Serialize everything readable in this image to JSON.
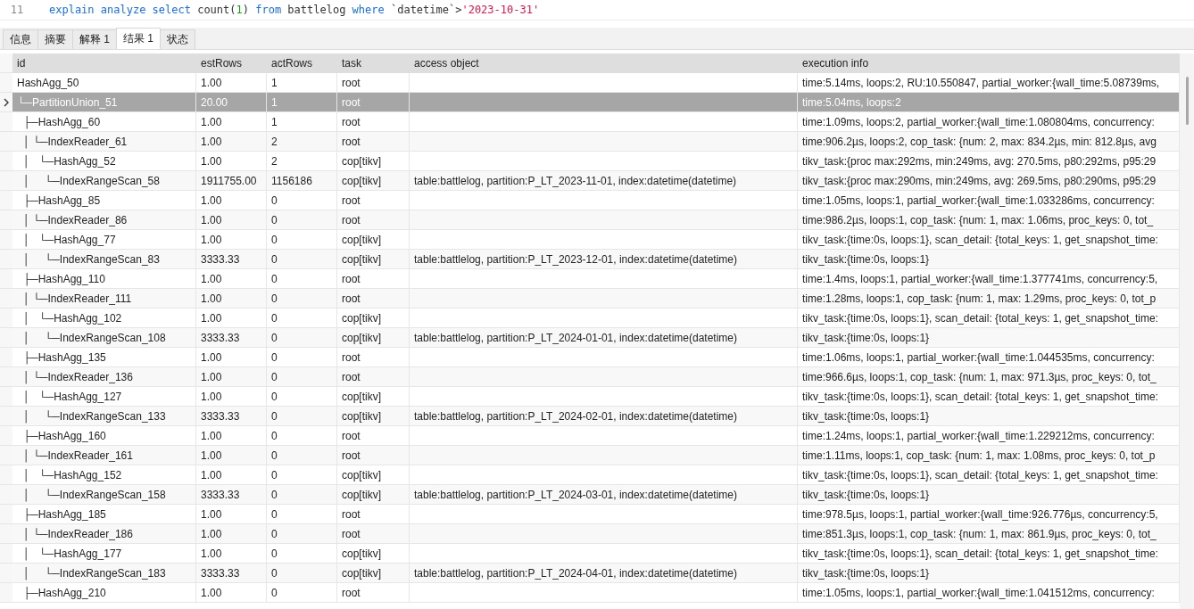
{
  "editor": {
    "line_number": "11",
    "tokens": [
      {
        "kind": "keyword",
        "text": "explain analyze select "
      },
      {
        "kind": "plain",
        "text": "count("
      },
      {
        "kind": "number",
        "text": "1"
      },
      {
        "kind": "plain",
        "text": ") "
      },
      {
        "kind": "keyword",
        "text": "from "
      },
      {
        "kind": "plain",
        "text": "battlelog "
      },
      {
        "kind": "keyword",
        "text": "where "
      },
      {
        "kind": "plain",
        "text": "`datetime`>"
      },
      {
        "kind": "string",
        "text": "'2023-10-31'"
      }
    ]
  },
  "tabs": [
    {
      "label": "信息",
      "selected": false
    },
    {
      "label": "摘要",
      "selected": false
    },
    {
      "label": "解释 1",
      "selected": false
    },
    {
      "label": "结果 1",
      "selected": true
    },
    {
      "label": "状态",
      "selected": false
    }
  ],
  "table": {
    "columns": [
      "id",
      "estRows",
      "actRows",
      "task",
      "access object",
      "execution info"
    ],
    "rows": [
      {
        "selected": false,
        "cells": [
          "HashAgg_50",
          "1.00",
          "1",
          "root",
          "",
          "time:5.14ms, loops:2, RU:10.550847, partial_worker:{wall_time:5.08739ms,"
        ]
      },
      {
        "selected": true,
        "cells": [
          "└─PartitionUnion_51",
          "20.00",
          "1",
          "root",
          "",
          "time:5.04ms, loops:2"
        ]
      },
      {
        "selected": false,
        "cells": [
          "  ├─HashAgg_60",
          "1.00",
          "1",
          "root",
          "",
          "time:1.09ms, loops:2, partial_worker:{wall_time:1.080804ms, concurrency:"
        ]
      },
      {
        "selected": false,
        "cells": [
          "  │ └─IndexReader_61",
          "1.00",
          "2",
          "root",
          "",
          "time:906.2µs, loops:2, cop_task: {num: 2, max: 834.2µs, min: 812.8µs, avg"
        ]
      },
      {
        "selected": false,
        "cells": [
          "  │   └─HashAgg_52",
          "1.00",
          "2",
          "cop[tikv]",
          "",
          "tikv_task:{proc max:292ms, min:249ms, avg: 270.5ms, p80:292ms, p95:29"
        ]
      },
      {
        "selected": false,
        "cells": [
          "  │     └─IndexRangeScan_58",
          "1911755.00",
          "1156186",
          "cop[tikv]",
          "table:battlelog, partition:P_LT_2023-11-01, index:datetime(datetime)",
          "tikv_task:{proc max:290ms, min:249ms, avg: 269.5ms, p80:290ms, p95:29"
        ]
      },
      {
        "selected": false,
        "cells": [
          "  ├─HashAgg_85",
          "1.00",
          "0",
          "root",
          "",
          "time:1.05ms, loops:1, partial_worker:{wall_time:1.033286ms, concurrency:"
        ]
      },
      {
        "selected": false,
        "cells": [
          "  │ └─IndexReader_86",
          "1.00",
          "0",
          "root",
          "",
          "time:986.2µs, loops:1, cop_task: {num: 1, max: 1.06ms, proc_keys: 0, tot_"
        ]
      },
      {
        "selected": false,
        "cells": [
          "  │   └─HashAgg_77",
          "1.00",
          "0",
          "cop[tikv]",
          "",
          "tikv_task:{time:0s, loops:1}, scan_detail: {total_keys: 1, get_snapshot_time:"
        ]
      },
      {
        "selected": false,
        "cells": [
          "  │     └─IndexRangeScan_83",
          "3333.33",
          "0",
          "cop[tikv]",
          "table:battlelog, partition:P_LT_2023-12-01, index:datetime(datetime)",
          "tikv_task:{time:0s, loops:1}"
        ]
      },
      {
        "selected": false,
        "cells": [
          "  ├─HashAgg_110",
          "1.00",
          "0",
          "root",
          "",
          "time:1.4ms, loops:1, partial_worker:{wall_time:1.377741ms, concurrency:5,"
        ]
      },
      {
        "selected": false,
        "cells": [
          "  │ └─IndexReader_111",
          "1.00",
          "0",
          "root",
          "",
          "time:1.28ms, loops:1, cop_task: {num: 1, max: 1.29ms, proc_keys: 0, tot_p"
        ]
      },
      {
        "selected": false,
        "cells": [
          "  │   └─HashAgg_102",
          "1.00",
          "0",
          "cop[tikv]",
          "",
          "tikv_task:{time:0s, loops:1}, scan_detail: {total_keys: 1, get_snapshot_time:"
        ]
      },
      {
        "selected": false,
        "cells": [
          "  │     └─IndexRangeScan_108",
          "3333.33",
          "0",
          "cop[tikv]",
          "table:battlelog, partition:P_LT_2024-01-01, index:datetime(datetime)",
          "tikv_task:{time:0s, loops:1}"
        ]
      },
      {
        "selected": false,
        "cells": [
          "  ├─HashAgg_135",
          "1.00",
          "0",
          "root",
          "",
          "time:1.06ms, loops:1, partial_worker:{wall_time:1.044535ms, concurrency:"
        ]
      },
      {
        "selected": false,
        "cells": [
          "  │ └─IndexReader_136",
          "1.00",
          "0",
          "root",
          "",
          "time:966.6µs, loops:1, cop_task: {num: 1, max: 971.3µs, proc_keys: 0, tot_"
        ]
      },
      {
        "selected": false,
        "cells": [
          "  │   └─HashAgg_127",
          "1.00",
          "0",
          "cop[tikv]",
          "",
          "tikv_task:{time:0s, loops:1}, scan_detail: {total_keys: 1, get_snapshot_time:"
        ]
      },
      {
        "selected": false,
        "cells": [
          "  │     └─IndexRangeScan_133",
          "3333.33",
          "0",
          "cop[tikv]",
          "table:battlelog, partition:P_LT_2024-02-01, index:datetime(datetime)",
          "tikv_task:{time:0s, loops:1}"
        ]
      },
      {
        "selected": false,
        "cells": [
          "  ├─HashAgg_160",
          "1.00",
          "0",
          "root",
          "",
          "time:1.24ms, loops:1, partial_worker:{wall_time:1.229212ms, concurrency:"
        ]
      },
      {
        "selected": false,
        "cells": [
          "  │ └─IndexReader_161",
          "1.00",
          "0",
          "root",
          "",
          "time:1.11ms, loops:1, cop_task: {num: 1, max: 1.08ms, proc_keys: 0, tot_p"
        ]
      },
      {
        "selected": false,
        "cells": [
          "  │   └─HashAgg_152",
          "1.00",
          "0",
          "cop[tikv]",
          "",
          "tikv_task:{time:0s, loops:1}, scan_detail: {total_keys: 1, get_snapshot_time:"
        ]
      },
      {
        "selected": false,
        "cells": [
          "  │     └─IndexRangeScan_158",
          "3333.33",
          "0",
          "cop[tikv]",
          "table:battlelog, partition:P_LT_2024-03-01, index:datetime(datetime)",
          "tikv_task:{time:0s, loops:1}"
        ]
      },
      {
        "selected": false,
        "cells": [
          "  ├─HashAgg_185",
          "1.00",
          "0",
          "root",
          "",
          "time:978.5µs, loops:1, partial_worker:{wall_time:926.776µs, concurrency:5,"
        ]
      },
      {
        "selected": false,
        "cells": [
          "  │ └─IndexReader_186",
          "1.00",
          "0",
          "root",
          "",
          "time:851.3µs, loops:1, cop_task: {num: 1, max: 861.9µs, proc_keys: 0, tot_"
        ]
      },
      {
        "selected": false,
        "cells": [
          "  │   └─HashAgg_177",
          "1.00",
          "0",
          "cop[tikv]",
          "",
          "tikv_task:{time:0s, loops:1}, scan_detail: {total_keys: 1, get_snapshot_time:"
        ]
      },
      {
        "selected": false,
        "cells": [
          "  │     └─IndexRangeScan_183",
          "3333.33",
          "0",
          "cop[tikv]",
          "table:battlelog, partition:P_LT_2024-04-01, index:datetime(datetime)",
          "tikv_task:{time:0s, loops:1}"
        ]
      },
      {
        "selected": false,
        "cells": [
          "  ├─HashAgg_210",
          "1.00",
          "0",
          "root",
          "",
          "time:1.05ms, loops:1, partial_worker:{wall_time:1.041512ms, concurrency:"
        ]
      }
    ]
  }
}
